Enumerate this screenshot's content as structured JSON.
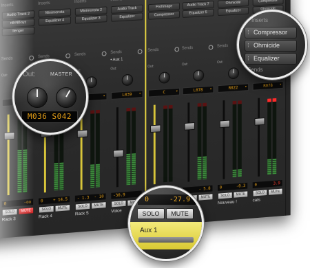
{
  "colors": {
    "selected_border": "#e9d642",
    "display_text": "#e6a018",
    "mute_active": "#e02a2a",
    "selected_channel": "#e9de5a"
  },
  "labels": {
    "inserts": "Inserts",
    "sends": "Sends",
    "out": "Out:",
    "master": "MASTER",
    "solo": "SOLO",
    "mute": "MUTE"
  },
  "channels": [
    {
      "inserts": [
        "Audio Track 2",
        "nthNBoyz",
        "llenger"
      ],
      "sends": "",
      "output": "",
      "fader_level": 0.78,
      "meter_level": 0.55,
      "peak_hot": false,
      "volume": "0",
      "pan": "-oo",
      "muted": true,
      "name": "Rack 3"
    },
    {
      "inserts": [
        "Minimonsta",
        "Equalizer 4"
      ],
      "sends": "",
      "output": "",
      "fader_level": 0.78,
      "meter_level": 0.35,
      "peak_hot": false,
      "volume": "0",
      "pan": "+ 14.5",
      "muted": false,
      "name": "Rack 4"
    },
    {
      "inserts": [
        "Minimonsta 2",
        "Equalizer 3"
      ],
      "sends": "",
      "output": "",
      "fader_level": 0.75,
      "meter_level": 0.3,
      "peak_hot": false,
      "volume": "- 1.3",
      "pan": "- 10",
      "muted": false,
      "name": "Rack 5"
    },
    {
      "inserts": [
        "Audio Track",
        "Equalizer"
      ],
      "sends": "• Aux 1",
      "output": "L039",
      "fader_level": 0.45,
      "meter_level": 0.4,
      "peak_hot": false,
      "volume": "-30.9",
      "pan": "",
      "muted": false,
      "name": "Voice"
    },
    {
      "inserts": [
        "Frohmage",
        "Compressor"
      ],
      "sends": "",
      "output": "C",
      "fader_level": 0.75,
      "meter_level": 0,
      "peak_hot": false,
      "volume": "0",
      "pan": "-27.9",
      "muted": false,
      "name": "Aux 1",
      "selected": true
    },
    {
      "inserts": [
        "Audio Track 7",
        "Equalizer 5"
      ],
      "sends": "",
      "output": "L078",
      "fader_level": 0.75,
      "meter_level": 0.3,
      "peak_hot": false,
      "volume": "",
      "pan": "- 5.8",
      "muted": false,
      "name": "quick"
    },
    {
      "inserts": [
        "Ohmicide",
        "Equalizer"
      ],
      "sends": "",
      "output": "R022",
      "fader_level": 0.75,
      "meter_level": 0.1,
      "peak_hot": false,
      "volume": "0",
      "pan": "-0.3",
      "muted": false,
      "name": "Nouveau !"
    },
    {
      "inserts": [
        "Compressor",
        "Ohmicide",
        "Equalizer"
      ],
      "sends": "",
      "output": "R078",
      "fader_level": 0.75,
      "meter_level": 0.2,
      "peak_hot": true,
      "volume": "0",
      "pan": "3.9",
      "pan_red": true,
      "muted": false,
      "name": "cats"
    }
  ],
  "zoom_output": {
    "label": "Out:",
    "master": "MASTER",
    "display": "M036 S042"
  },
  "zoom_inserts": {
    "header": "Inserts",
    "items": [
      "Compressor",
      "Ohmicide",
      "Equalizer"
    ],
    "sends": "Sends"
  },
  "zoom_channel": {
    "volume": "0",
    "pan": "-27.9",
    "solo": "SOLO",
    "mute": "MUTE",
    "name": "Aux 1"
  }
}
